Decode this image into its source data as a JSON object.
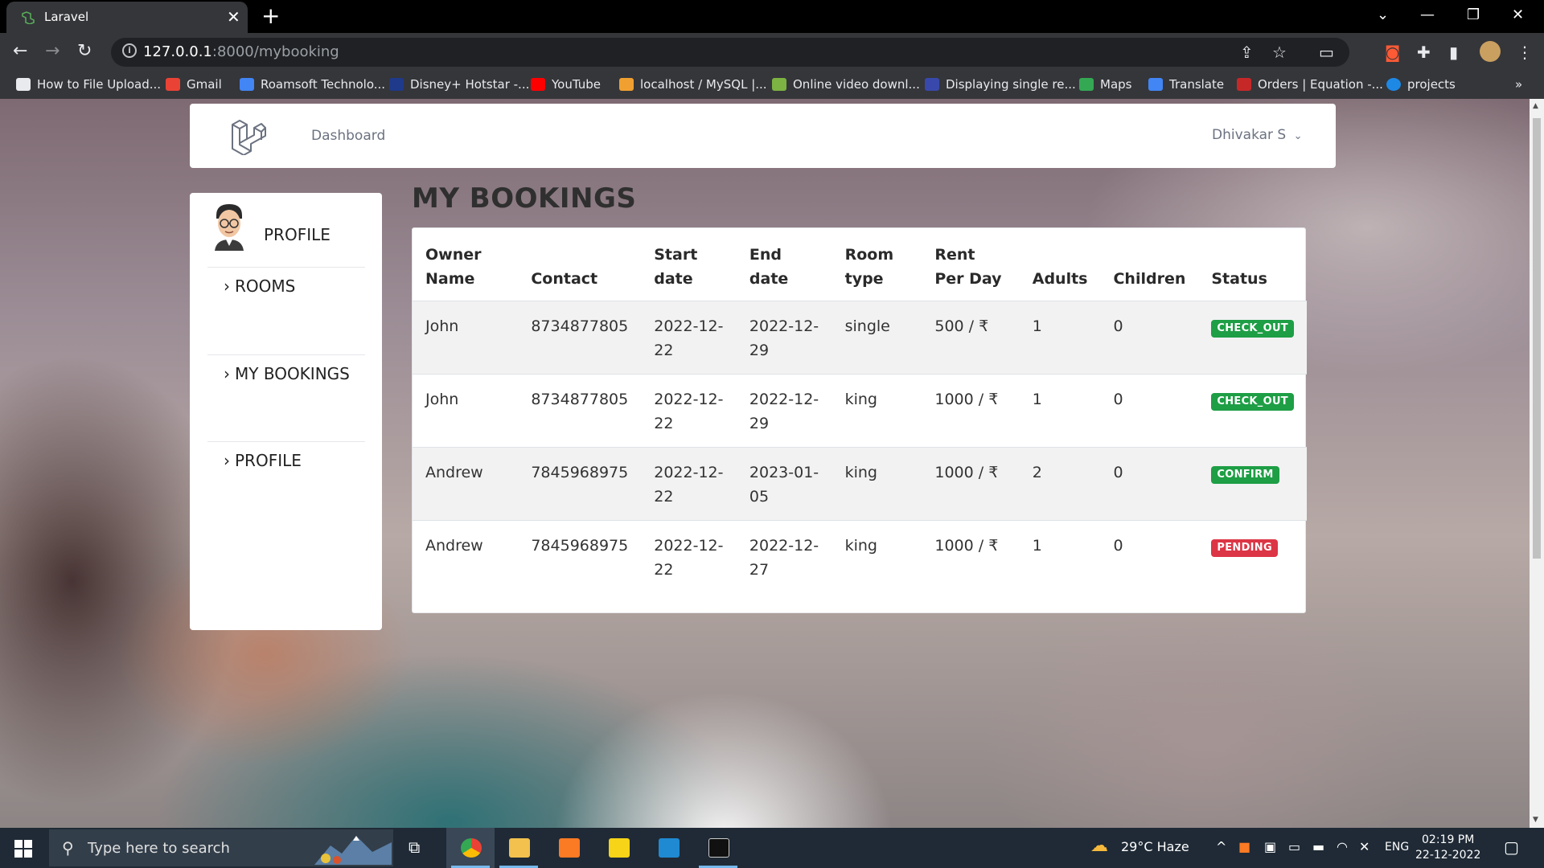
{
  "browser": {
    "tab_title": "Laravel",
    "url_host": "127.0.0.1",
    "url_path": ":8000/mybooking",
    "bookmarks": [
      {
        "label": "How to File Upload...",
        "icon": "bookmark-favicon",
        "color": "#e8eaed"
      },
      {
        "label": "Gmail",
        "icon": "gmail-icon",
        "color": "#ea4335"
      },
      {
        "label": "Roamsoft Technolo...",
        "icon": "roamsoft-icon",
        "color": "#4285f4"
      },
      {
        "label": "Disney+ Hotstar -...",
        "icon": "hotstar-icon",
        "color": "#1f3a8a"
      },
      {
        "label": "YouTube",
        "icon": "youtube-icon",
        "color": "#ff0000"
      },
      {
        "label": "localhost / MySQL |...",
        "icon": "phpmyadmin-icon",
        "color": "#f0a030"
      },
      {
        "label": "Online video downl...",
        "icon": "download-icon",
        "color": "#7cb342"
      },
      {
        "label": "Displaying single re...",
        "icon": "site-icon",
        "color": "#3949ab"
      },
      {
        "label": "Maps",
        "icon": "maps-icon",
        "color": "#34a853"
      },
      {
        "label": "Translate",
        "icon": "translate-icon",
        "color": "#4285f4"
      },
      {
        "label": "Orders | Equation -...",
        "icon": "orders-icon",
        "color": "#c62828"
      },
      {
        "label": "projects",
        "icon": "projects-icon",
        "color": "#1e88e5"
      }
    ],
    "more_bookmarks": "»"
  },
  "nav": {
    "dashboard_label": "Dashboard",
    "user_name": "Dhivakar S"
  },
  "sidebar": {
    "profile_heading": "PROFILE",
    "items": [
      {
        "label": "ROOMS"
      },
      {
        "label": "MY BOOKINGS"
      },
      {
        "label": "PROFILE"
      }
    ]
  },
  "bookings": {
    "title": "MY BOOKINGS",
    "columns": [
      "Owner Name",
      "Contact",
      "Start date",
      "End date",
      "Room type",
      "Rent Per Day",
      "Adults",
      "Children",
      "Status"
    ],
    "rows": [
      {
        "owner": "John",
        "contact": "8734877805",
        "start": "2022-12-22",
        "end": "2022-12-29",
        "room": "single",
        "rent": "500 / ₹",
        "adults": "1",
        "children": "0",
        "status": "CHECK_OUT",
        "status_color": "#1e9e45"
      },
      {
        "owner": "John",
        "contact": "8734877805",
        "start": "2022-12-22",
        "end": "2022-12-29",
        "room": "king",
        "rent": "1000 / ₹",
        "adults": "1",
        "children": "0",
        "status": "CHECK_OUT",
        "status_color": "#1e9e45"
      },
      {
        "owner": "Andrew",
        "contact": "7845968975",
        "start": "2022-12-22",
        "end": "2023-01-05",
        "room": "king",
        "rent": "1000 / ₹",
        "adults": "2",
        "children": "0",
        "status": "CONFIRM",
        "status_color": "#1e9e45"
      },
      {
        "owner": "Andrew",
        "contact": "7845968975",
        "start": "2022-12-22",
        "end": "2022-12-27",
        "room": "king",
        "rent": "1000 / ₹",
        "adults": "1",
        "children": "0",
        "status": "PENDING",
        "status_color": "#dc3545"
      }
    ]
  },
  "taskbar": {
    "search_placeholder": "Type here to search",
    "weather": "29°C  Haze",
    "language": "ENG",
    "time": "02:19 PM",
    "date": "22-12-2022"
  }
}
